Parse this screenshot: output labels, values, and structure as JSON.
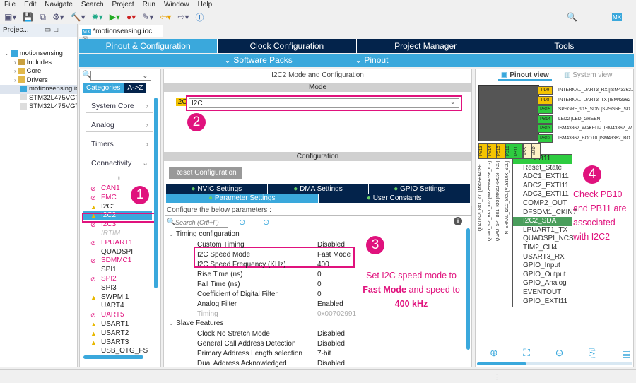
{
  "menu": [
    "File",
    "Edit",
    "Navigate",
    "Search",
    "Project",
    "Run",
    "Window",
    "Help"
  ],
  "project_panel": {
    "title": "Projec...",
    "tree": [
      {
        "label": "motionsensing",
        "icon": "ide-project-icon"
      },
      {
        "label": "Includes",
        "icon": "includes-folder-icon"
      },
      {
        "label": "Core",
        "icon": "folder-icon"
      },
      {
        "label": "Drivers",
        "icon": "folder-icon"
      },
      {
        "label": "motionsensing.ioc",
        "icon": "mx-file-icon"
      },
      {
        "label": "STM32L475VGTX_",
        "icon": "ld-file-icon"
      },
      {
        "label": "STM32L475VGTX_",
        "icon": "ld-file-icon"
      }
    ]
  },
  "editor_tab": {
    "label": "*motionsensing.ioc",
    "icon": "MX"
  },
  "top_tabs": [
    "Pinout & Configuration",
    "Clock Configuration",
    "Project Manager",
    "Tools"
  ],
  "sub_menu": {
    "software_packs": "Software Packs",
    "pinout": "Pinout"
  },
  "categories": {
    "tabs": [
      "Categories",
      "A->Z"
    ],
    "groups": [
      "System Core",
      "Analog",
      "Timers",
      "Connectivity"
    ],
    "peripherals": [
      {
        "name": "CAN1",
        "status": "blocked"
      },
      {
        "name": "FMC",
        "status": "blocked"
      },
      {
        "name": "I2C1",
        "status": "warning"
      },
      {
        "name": "I2C2",
        "status": "warning",
        "selected": true
      },
      {
        "name": "I2C3",
        "status": "blocked"
      },
      {
        "name": "IRTIM",
        "status": "disabled"
      },
      {
        "name": "LPUART1",
        "status": "blocked"
      },
      {
        "name": "QUADSPI",
        "status": "none"
      },
      {
        "name": "SDMMC1",
        "status": "blocked"
      },
      {
        "name": "SPI1",
        "status": "none"
      },
      {
        "name": "SPI2",
        "status": "blocked"
      },
      {
        "name": "SPI3",
        "status": "none"
      },
      {
        "name": "SWPMI1",
        "status": "warning"
      },
      {
        "name": "UART4",
        "status": "none"
      },
      {
        "name": "UART5",
        "status": "blocked"
      },
      {
        "name": "USART1",
        "status": "warning"
      },
      {
        "name": "USART2",
        "status": "warning"
      },
      {
        "name": "USART3",
        "status": "warning"
      },
      {
        "name": "USB_OTG_FS",
        "status": "none"
      }
    ]
  },
  "mode_panel": {
    "title": "I2C2 Mode and Configuration",
    "mode_header": "Mode",
    "field_label": "I2C",
    "field_value": "I2C",
    "config_header": "Configuration",
    "reset_button": "Reset Configuration",
    "tabs_row1": [
      "NVIC Settings",
      "DMA Settings",
      "GPIO Settings"
    ],
    "tabs_row2": [
      "Parameter Settings",
      "User Constants"
    ],
    "configure_text": "Configure the below parameters :",
    "search_placeholder": "Search (Crtl+F)",
    "sections": [
      {
        "title": "Timing configuration",
        "params": [
          [
            "Custom Timing",
            "Disabled"
          ],
          [
            "I2C Speed Mode",
            "Fast Mode"
          ],
          [
            "I2C Speed Frequency (KHz)",
            "400"
          ],
          [
            "Rise Time (ns)",
            "0"
          ],
          [
            "Fall Time (ns)",
            "0"
          ],
          [
            "Coefficient of Digital Filter",
            "0"
          ],
          [
            "Analog Filter",
            "Enabled"
          ],
          [
            "Timing",
            "0x00702991"
          ]
        ]
      },
      {
        "title": "Slave Features",
        "params": [
          [
            "Clock No Stretch Mode",
            "Disabled"
          ],
          [
            "General Call Address Detection",
            "Disabled"
          ],
          [
            "Primary Address Length selection",
            "7-bit"
          ],
          [
            "Dual Address Acknowledged",
            "Disabled"
          ]
        ]
      }
    ]
  },
  "annotations": {
    "step1": "1",
    "step2": "2",
    "step3": "3",
    "step4": "4",
    "note3_a": "Set I2C speed mode to ",
    "note3_b": "Fast Mode",
    "note3_c": " and speed to ",
    "note3_d": "400 kHz",
    "note4": "Check PB10 and PB11 are associated with I2C2",
    "accent": "#e0127d"
  },
  "pinout": {
    "tabs": [
      "Pinout view",
      "System view"
    ],
    "right_pins": [
      {
        "pin": "PD9",
        "label": "INTERNAL_UART3_RX [ISM43362...",
        "color": "#f5c400"
      },
      {
        "pin": "PD8",
        "label": "INTERNAL_UART3_TX [ISM43362_",
        "color": "#f5c400"
      },
      {
        "pin": "PB15",
        "label": "SPSGRF_915_SDN [SPSGRF_SD",
        "color": "#2ecc40"
      },
      {
        "pin": "PB14",
        "label": "LED2 [LED_GREEN]",
        "color": "#2ecc40"
      },
      {
        "pin": "PB13",
        "label": "ISM43362_WAKEUP [ISM43362_W",
        "color": "#2ecc40"
      },
      {
        "pin": "PB12",
        "label": "ISM43362_BOOT0 [ISM43362_BO",
        "color": "#2ecc40"
      }
    ],
    "bottom_pins": [
      {
        "pin": "PE13",
        "color": "#f5c400"
      },
      {
        "pin": "PE14",
        "color": "#f5c400"
      },
      {
        "pin": "PE15",
        "color": "#f5c400"
      },
      {
        "pin": "PB10",
        "color": "#2ecc40"
      },
      {
        "pin": "PB11",
        "color": "#2ecc40"
      },
      {
        "pin": "VSS",
        "color": "#fff3c8"
      },
      {
        "pin": "VDD",
        "color": "#fff3c8"
      }
    ],
    "bottom_labels": [
      "QUADSPI_BK1_IO1 [MX25R6435F...",
      "QUAD_SPI_BK1_IO2 [MX25R6435F_IO2]",
      "QUAD_SPI_BK1_IO3 [MX25R6435F_IO3]",
      "INTERNAL_I2C2_SCL [VL53L0X_SCL]"
    ],
    "popup": {
      "title": "PB11",
      "items": [
        "Reset_State",
        "ADC1_EXTI11",
        "ADC2_EXTI11",
        "ADC3_EXTI11",
        "COMP2_OUT",
        "DFSDM1_CKIN7",
        "I2C2_SDA",
        "LPUART1_TX",
        "QUADSPI_NCS",
        "TIM2_CH4",
        "USART3_RX",
        "GPIO_Input",
        "GPIO_Output",
        "GPIO_Analog",
        "EVENTOUT",
        "GPIO_EXTI11"
      ],
      "selected": "I2C2_SDA"
    }
  }
}
